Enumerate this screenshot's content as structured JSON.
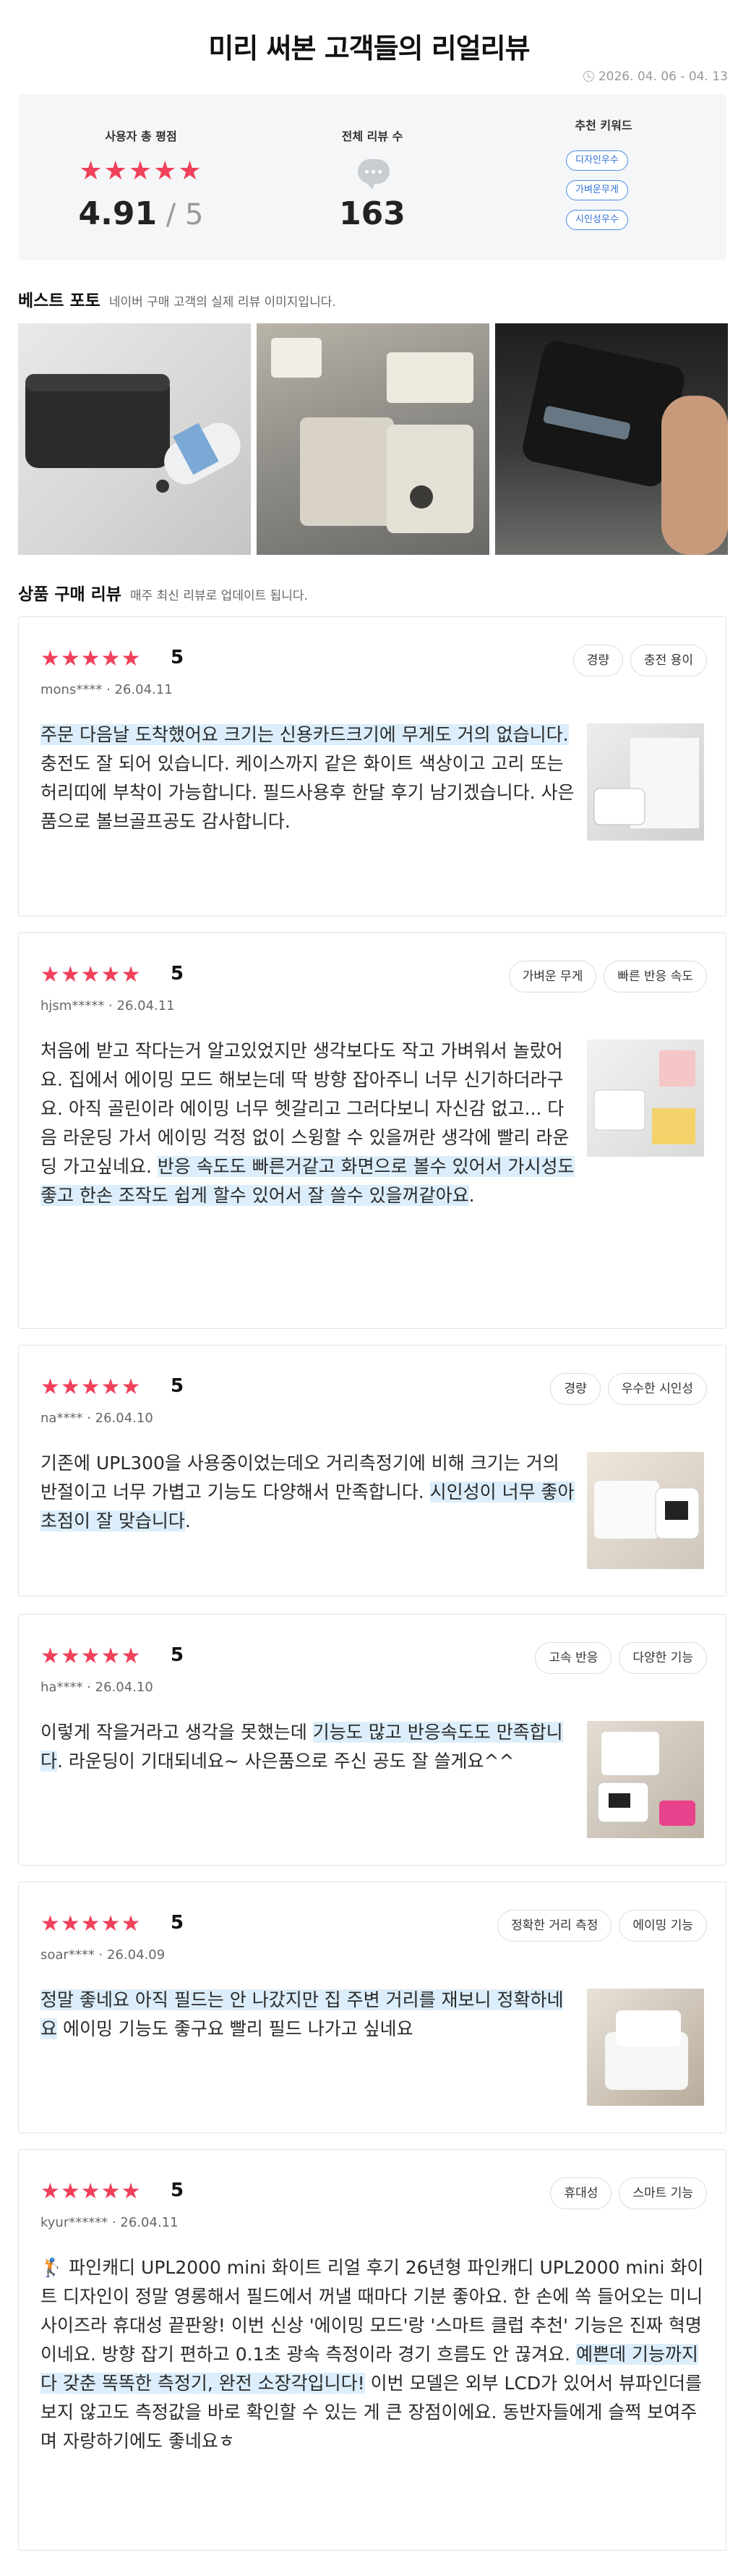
{
  "header": {
    "title": "미리 써본 고객들의 리얼리뷰",
    "period": "2026. 04. 06 - 04. 13"
  },
  "summary": {
    "avg_label": "사용자 총 평점",
    "avg_value": "4.91",
    "avg_max": "5",
    "count_label": "전체 리뷰 수",
    "count_value": "163",
    "keywords_label": "추천 키워드",
    "keywords": [
      "디자인우수",
      "가벼운무게",
      "시인성우수"
    ]
  },
  "best_photo": {
    "title": "베스트 포토",
    "subtitle": "네이버 구매 고객의 실제 리뷰 이미지입니다."
  },
  "reviews_section": {
    "title": "상품 구매 리뷰",
    "subtitle": "매주 최신 리뷰로 업데이트 됩니다."
  },
  "reviews": [
    {
      "score": "5",
      "user": "mons****",
      "date": "26.04.11",
      "tags": [
        "경량",
        "충전 용이"
      ],
      "parts": [
        {
          "text": "주문 다음날 도착했어요 크기는 신용카드크기에 무게도 거의 없습니다.",
          "hl": true
        },
        {
          "text": " 충전도 잘 되어 있습니다. 케이스까지 같은 화이트 색상이고 고리 또는 허리띠에 부착이 가능합니다. 필드사용후 한달 후기 남기겠습니다. 사은품으로 볼브골프공도 감사합니다.",
          "hl": false
        }
      ]
    },
    {
      "score": "5",
      "user": "hjsm*****",
      "date": "26.04.11",
      "tags": [
        "가벼운 무게",
        "빠른 반응 속도"
      ],
      "parts": [
        {
          "text": "처음에 받고 작다는거 알고있었지만 생각보다도 작고 가벼워서 놀랐어요. 집에서 에이밍 모드 해보는데 딱 방향 잡아주니 너무 신기하더라구요. 아직 골린이라 에이밍 너무 헷갈리고 그러다보니 자신감 없고... 다음 라운딩 가서 에이밍 걱정 없이 스윙할 수 있을꺼란 생각에 빨리 라운딩 가고싶네요. ",
          "hl": false
        },
        {
          "text": "반응 속도도 빠른거같고 화면으로 볼수 있어서 가시성도 좋고 한손 조작도 쉽게 할수 있어서 잘 쓸수 있을꺼같아요",
          "hl": true
        },
        {
          "text": ".",
          "hl": false
        }
      ]
    },
    {
      "score": "5",
      "user": "na****",
      "date": "26.04.10",
      "tags": [
        "경량",
        "우수한 시인성"
      ],
      "parts": [
        {
          "text": "기존에 UPL300을 사용중이었는데오 거리측정기에 비해 크기는 거의 반절이고 너무 가볍고 기능도 다양해서 만족합니다. ",
          "hl": false
        },
        {
          "text": "시인성이 너무 좋아 초점이 잘 맞습니다",
          "hl": true
        },
        {
          "text": ".",
          "hl": false
        }
      ]
    },
    {
      "score": "5",
      "user": "ha****",
      "date": "26.04.10",
      "tags": [
        "고속 반응",
        "다양한 기능"
      ],
      "parts": [
        {
          "text": "이렇게 작을거라고 생각을 못했는데 ",
          "hl": false
        },
        {
          "text": "기능도 많고 반응속도도 만족합니다",
          "hl": true
        },
        {
          "text": ". 라운딩이 기대되네요~ 사은품으로 주신 공도 잘 쓸게요^^",
          "hl": false
        }
      ]
    },
    {
      "score": "5",
      "user": "soar****",
      "date": "26.04.09",
      "tags": [
        "정확한 거리 측정",
        "에이밍 기능"
      ],
      "parts": [
        {
          "text": "정말 좋네요 아직 필드는 안 나갔지만 집 주변 거리를 재보니 정확하네요",
          "hl": true
        },
        {
          "text": " 에이밍 기능도 좋구요 빨리 필드 나가고 싶네요",
          "hl": false
        }
      ]
    },
    {
      "score": "5",
      "user": "kyur******",
      "date": "26.04.11",
      "tags": [
        "휴대성",
        "스마트 기능"
      ],
      "parts": [
        {
          "text": "🏌️ 파인캐디 UPL2000 mini 화이트 리얼 후기 26년형 파인캐디 UPL2000 mini 화이트 디자인이 정말 영롱해서 필드에서 꺼낼 때마다 기분 좋아요. 한 손에 쏙 들어오는 미니 사이즈라 휴대성 끝판왕! 이번 신상 '에이밍 모드'랑 '스마트 클럽 추천' 기능은 진짜 혁명이네요. 방향 잡기 편하고 0.1초 광속 측정이라 경기 흐름도 안 끊겨요. ",
          "hl": false
        },
        {
          "text": "예쁜데 기능까지 다 갖춘 똑똑한 측정기, 완전 소장각입니다!",
          "hl": true
        },
        {
          "text": " 이번 모델은 외부 LCD가 있어서 뷰파인더를 보지 않고도 측정값을 바로 확인할 수 있는 게 큰 장점이에요. 동반자들에게 슬쩍 보여주며 자랑하기에도 좋네요ㅎ",
          "hl": false
        }
      ]
    }
  ]
}
